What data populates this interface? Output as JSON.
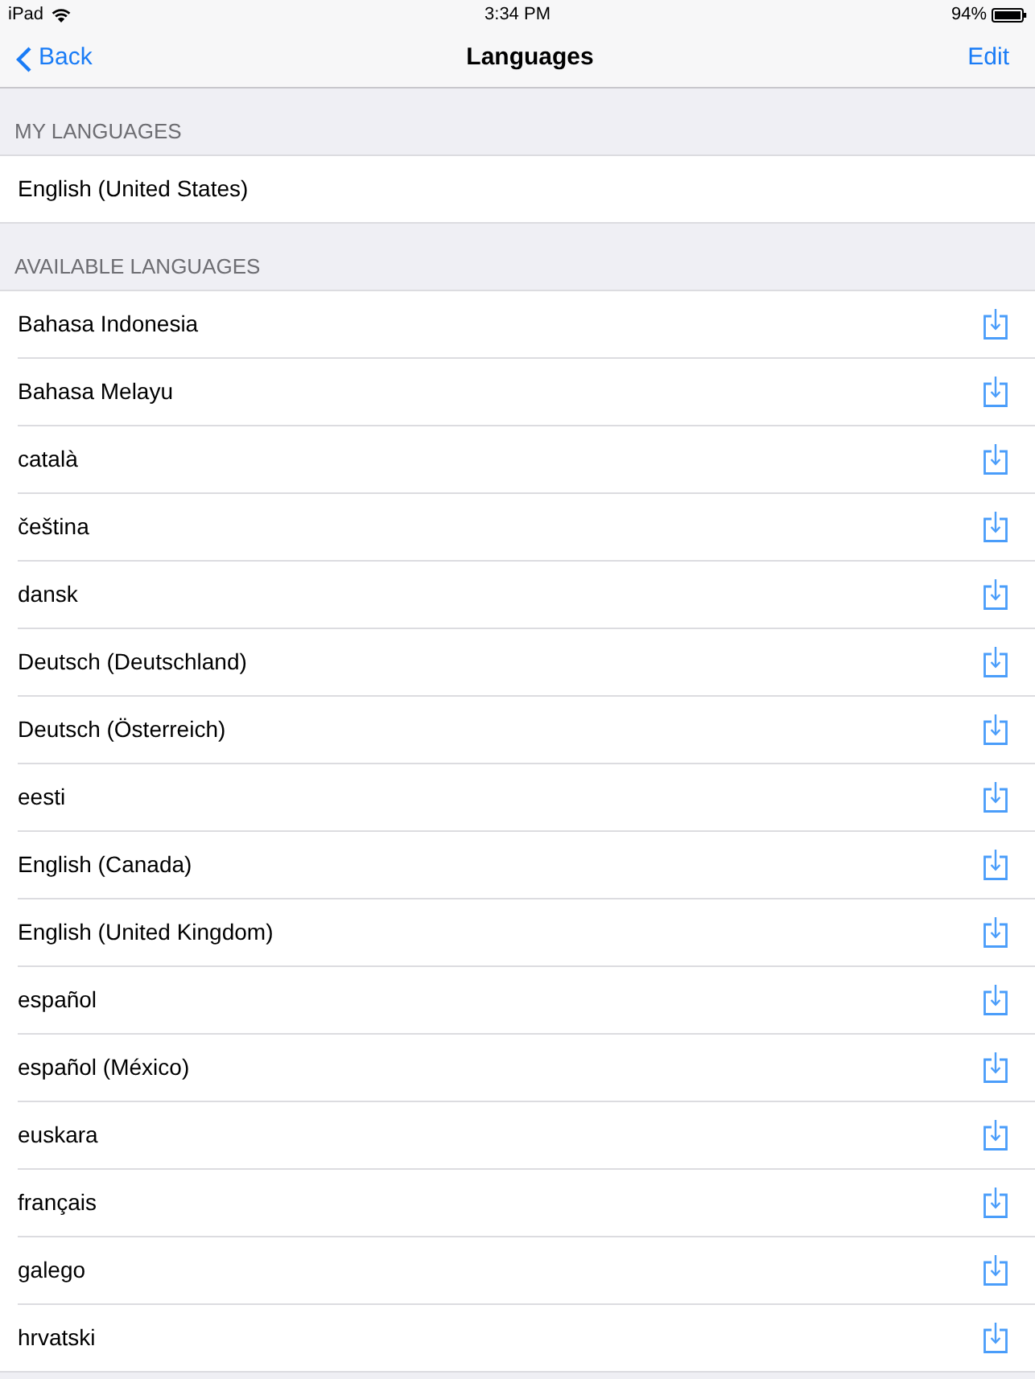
{
  "status_bar": {
    "device": "iPad",
    "time": "3:34 PM",
    "battery": "94%"
  },
  "nav_bar": {
    "back": "Back",
    "title": "Languages",
    "action": "Edit"
  },
  "sections": [
    {
      "header": "MY LANGUAGES",
      "rows": [
        {
          "label": "English (United States)",
          "kind": "plain"
        }
      ]
    },
    {
      "header": "AVAILABLE LANGUAGES",
      "rows": [
        {
          "label": "Bahasa Indonesia",
          "kind": "download"
        },
        {
          "label": "Bahasa Melayu",
          "kind": "download"
        },
        {
          "label": "català",
          "kind": "download"
        },
        {
          "label": "čeština",
          "kind": "download"
        },
        {
          "label": "dansk",
          "kind": "download"
        },
        {
          "label": "Deutsch (Deutschland)",
          "kind": "download"
        },
        {
          "label": "Deutsch (Österreich)",
          "kind": "download"
        },
        {
          "label": "eesti",
          "kind": "download"
        },
        {
          "label": "English (Canada)",
          "kind": "download"
        },
        {
          "label": "English (United Kingdom)",
          "kind": "download"
        },
        {
          "label": "español",
          "kind": "download"
        },
        {
          "label": "español (México)",
          "kind": "download"
        },
        {
          "label": "euskara",
          "kind": "download"
        },
        {
          "label": "français",
          "kind": "download"
        },
        {
          "label": "galego",
          "kind": "download"
        },
        {
          "label": "hrvatski",
          "kind": "download"
        }
      ]
    }
  ]
}
